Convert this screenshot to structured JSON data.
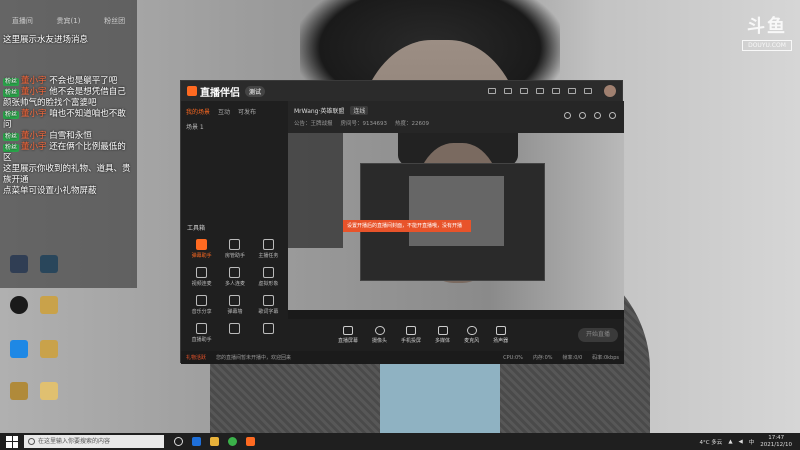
{
  "desktop": {
    "watermark": {
      "logo": "斗鱼",
      "sub": "DOUYU.COM"
    }
  },
  "chat": {
    "stats": [
      "直播间",
      "贵宾(1)",
      "粉丝团"
    ],
    "tabs": [
      "",
      "",
      ""
    ],
    "messages": [
      {
        "text": "这里展示水友进场消息"
      },
      {
        "badge": "粉丝",
        "nick": "董小宇",
        "text": "不会也是躺平了吧"
      },
      {
        "badge": "粉丝",
        "nick": "董小宇",
        "text": "他不会是想凭借自己颜张帅气的脸找个富婆吧"
      },
      {
        "badge": "粉丝",
        "nick": "董小宇",
        "text": "咱也不知道咱也不敢问"
      },
      {
        "badge": "粉丝",
        "nick": "董小宇",
        "text": "白雪和永恒"
      },
      {
        "badge": "粉丝",
        "nick": "董小宇",
        "text": "还在俩个比例最低的区"
      },
      {
        "text": "这里展示你收到的礼物、道具、贵族开通"
      },
      {
        "text": "点菜单可设置小礼物屏蔽"
      }
    ]
  },
  "app": {
    "title": "直播伴侣",
    "version": "测试",
    "left_tabs": [
      "我的场景",
      "互动",
      "可发布"
    ],
    "scene": "场景 1",
    "tools_title": "工具箱",
    "tools": [
      "弹幕助手",
      "房管助手",
      "主播任务",
      "视频连麦",
      "多人连麦",
      "虚拟形象",
      "音乐分享",
      "弹幕墙",
      "歌词字幕",
      "直播助手",
      "",
      ""
    ],
    "room": {
      "name": "MrWang·英雄联盟",
      "tag": "连线"
    },
    "room_info": [
      "公告：王牌战报",
      "房间号：9134693",
      "热度：22609"
    ],
    "banner": "设置开播后的直播间封面，不能开直播哦，没有开播",
    "controls": [
      "直播屏幕",
      "摄像头",
      "手机投屏",
      "多媒体",
      "麦克风",
      "扬声器"
    ],
    "start_live": "开始直播",
    "status": [
      "礼物活跃",
      "您的直播间暂未开播中，欢迎回来",
      "CPU:0%",
      "内存:0%",
      "帧率:0/0",
      "码率:0kbps"
    ]
  },
  "taskbar": {
    "search_placeholder": "在这里输入你要搜索的内容",
    "weather": "4°C 多云",
    "lang": "中",
    "time": "17:47",
    "date": "2021/12/10"
  }
}
